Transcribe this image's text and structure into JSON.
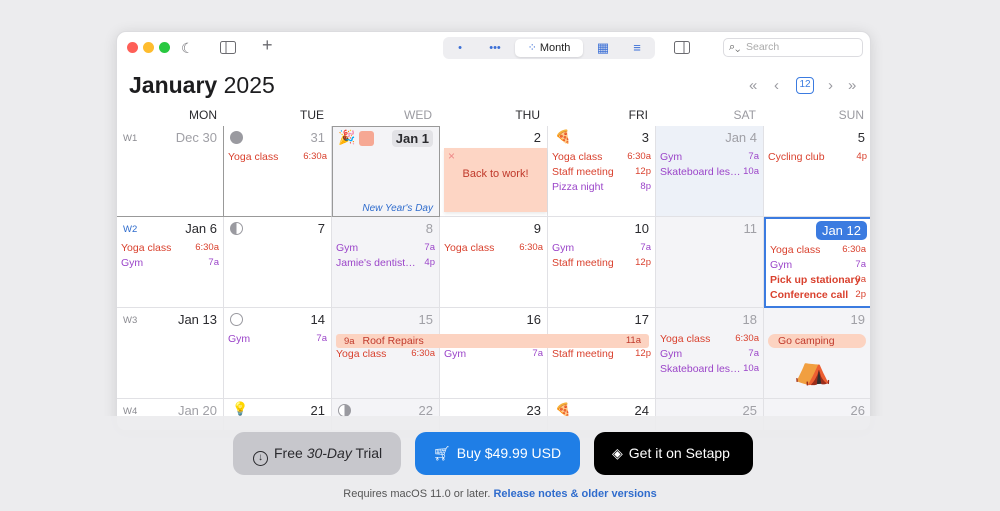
{
  "window": {
    "search_placeholder": "Search",
    "view_month": "Month"
  },
  "header": {
    "month": "January",
    "year": "2025",
    "today": "12"
  },
  "dow": [
    "MON",
    "TUE",
    "WED",
    "THU",
    "FRI",
    "SAT",
    "SUN"
  ],
  "weeks": [
    "W1",
    "W2",
    "W3",
    "W4"
  ],
  "days": {
    "d1": "Dec 30",
    "d2": "31",
    "d3": "Jan 1",
    "d4": "2",
    "d5": "3",
    "d6": "Jan 4",
    "d7": "5",
    "d8": "Jan 6",
    "d9": "7",
    "d10": "8",
    "d11": "9",
    "d12": "10",
    "d13": "11",
    "d14": "Jan 12",
    "d15": "Jan 13",
    "d16": "14",
    "d17": "15",
    "d18": "16",
    "d19": "17",
    "d20": "18",
    "d21": "19",
    "d22": "Jan 20",
    "d23": "21",
    "d24": "22",
    "d25": "23",
    "d26": "24",
    "d27": "25",
    "d28": "26"
  },
  "events": {
    "yoga": "Yoga class",
    "t630": "6:30a",
    "gym": "Gym",
    "t7": "7a",
    "cycling": "Cycling club",
    "t4p": "4p",
    "staff": "Staff meeting",
    "t12p": "12p",
    "pizza": "Pizza night",
    "t8p": "8p",
    "skate": "Skateboard les…",
    "t10a": "10a",
    "nyd": "New Year's Day",
    "back": "Back to work!",
    "dentist": "Jamie's dentist…",
    "stationary": "Pick up stationary",
    "t9a": "9a",
    "conf": "Conference call",
    "t2p": "2p",
    "roof": "Roof Repairs",
    "t11a": "11a",
    "camping": "Go camping"
  },
  "cta": {
    "trial_prefix": "Free ",
    "trial_em": "30-Day",
    "trial_suffix": " Trial",
    "buy": "Buy $49.99 USD",
    "setapp": "Get it on Setapp"
  },
  "footer": {
    "req": "Requires macOS 11.0 or later. ",
    "link": "Release notes & older versions"
  },
  "colors": {
    "accent": "#1f7ee6",
    "event_red": "#d9412e",
    "event_purple": "#9b45c9",
    "bar": "#fcd3c1"
  }
}
